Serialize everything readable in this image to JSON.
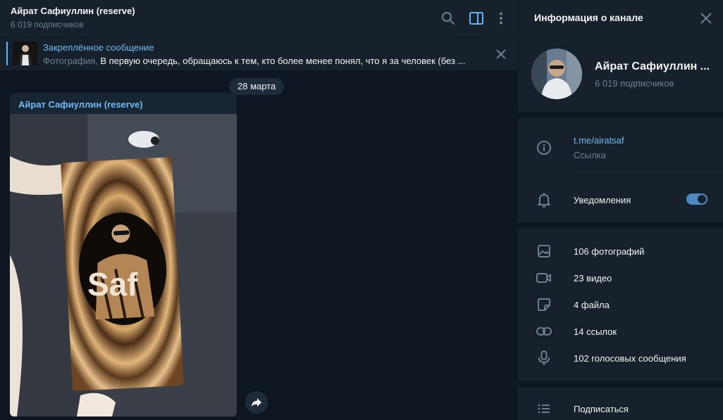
{
  "header": {
    "title": "Айрат Сафиуллин (reserve)",
    "subscribers": "6 019 подписчиков"
  },
  "pinned": {
    "title": "Закреплённое сообщение",
    "kind": "Фотография,",
    "text": "В первую очередь, обращаюсь к тем, кто более менее понял, что я за человек (без ..."
  },
  "date_pill": "28 марта",
  "message": {
    "author": "Айрат Сафиуллин (reserve)",
    "photo_text": "Saf"
  },
  "panel": {
    "title": "Информация о канале",
    "channel_name": "Айрат Сафиуллин ...",
    "subscribers": "6 019 подписчиков",
    "link": "t.me/airatsaf",
    "link_caption": "Ссылка",
    "notifications": "Уведомления",
    "notifications_on": true,
    "media": [
      {
        "label": "106 фотографий",
        "icon": "photo-icon"
      },
      {
        "label": "23 видео",
        "icon": "video-icon"
      },
      {
        "label": "4 файла",
        "icon": "file-icon"
      },
      {
        "label": "14 ссылок",
        "icon": "link-icon"
      },
      {
        "label": "102 голосовых сообщения",
        "icon": "microphone-icon"
      }
    ],
    "subscribe": "Подписаться"
  },
  "colors": {
    "accent": "#5288c1",
    "link": "#71baf2",
    "background": "#0e1621",
    "panel": "#17212b"
  }
}
